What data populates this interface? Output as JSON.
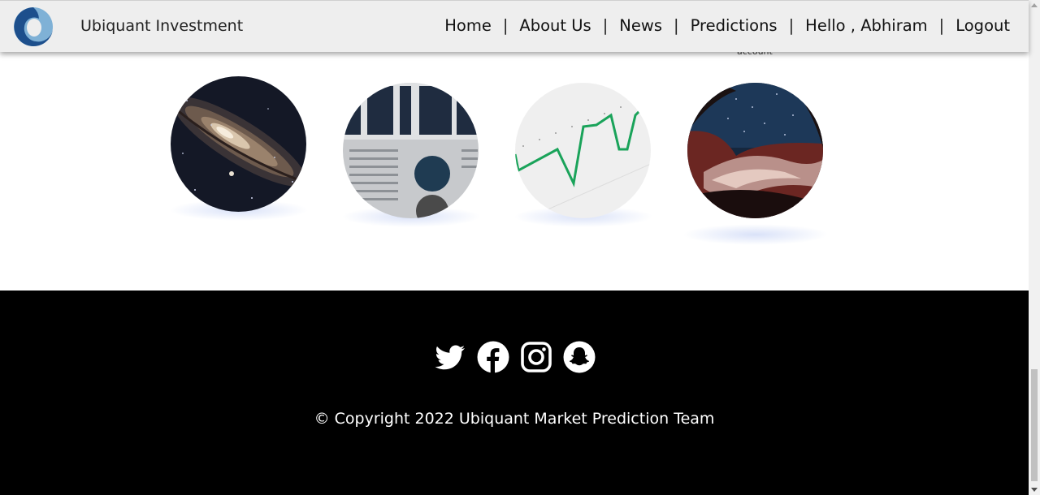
{
  "header": {
    "brand": "Ubiquant Investment",
    "logo_icon": "ubiquant-swirl-logo",
    "nav": [
      {
        "label": "Home"
      },
      {
        "label": "About Us"
      },
      {
        "label": "News"
      },
      {
        "label": "Predictions"
      },
      {
        "label": "Hello , Abhiram"
      },
      {
        "label": "Logout"
      }
    ],
    "separator": "|"
  },
  "partial_text": "account",
  "cards": [
    {
      "image": "galaxy-image"
    },
    {
      "image": "newspaper-image"
    },
    {
      "image": "line-chart-image"
    },
    {
      "image": "night-sky-canyon-image"
    }
  ],
  "footer": {
    "social": [
      "twitter-icon",
      "facebook-icon",
      "instagram-icon",
      "snapchat-icon"
    ],
    "copyright": "© Copyright 2022 Ubiquant Market Prediction Team"
  },
  "colors": {
    "navbar_bg": "#eeeeee",
    "footer_bg": "#000000",
    "logo_blue": "#1d4f8c",
    "chart_line": "#1aa35a"
  }
}
